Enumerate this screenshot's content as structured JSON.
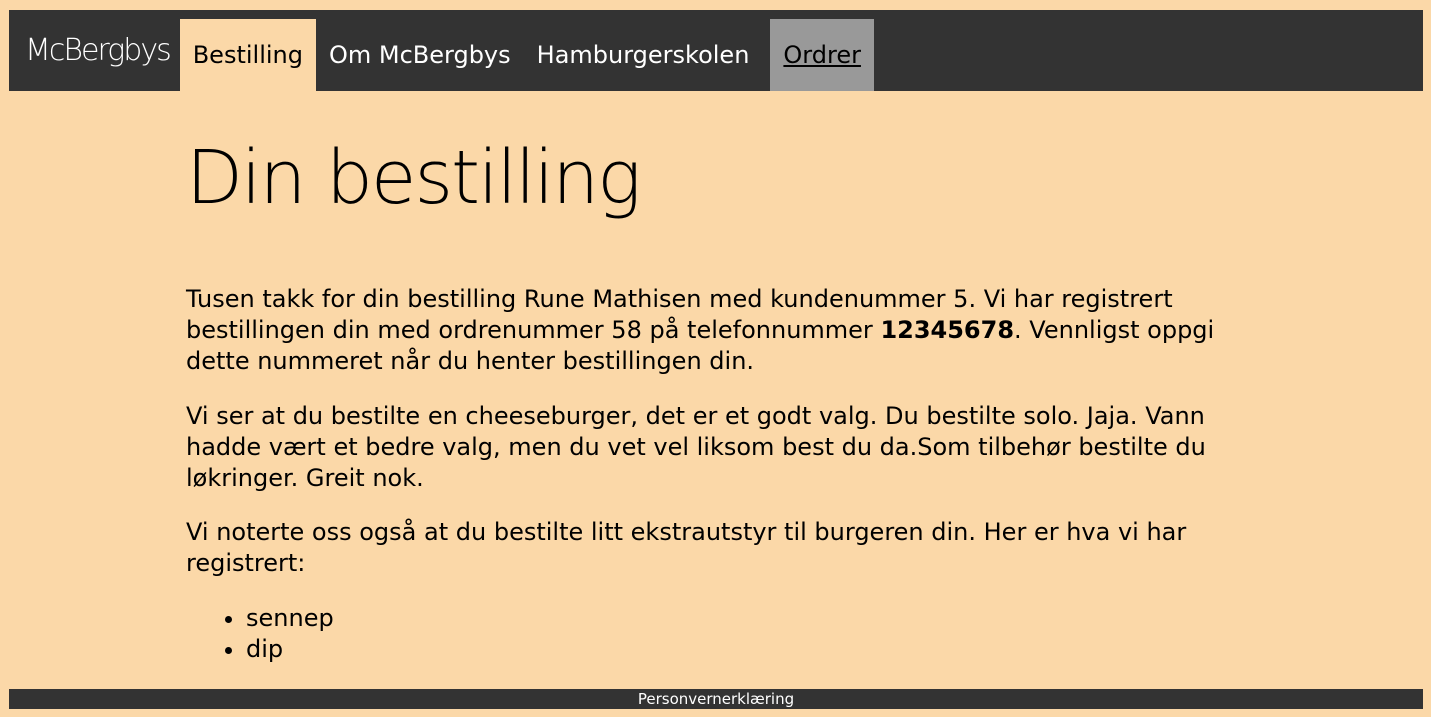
{
  "nav": {
    "brand": "McBergbys",
    "items": [
      {
        "label": "Bestilling"
      },
      {
        "label": "Om McBergbys"
      },
      {
        "label": "Hamburgerskolen"
      },
      {
        "label": "Ordrer"
      }
    ]
  },
  "main": {
    "title": "Din bestilling",
    "p1": {
      "before": "Tusen takk for din bestilling Rune Mathisen med kundenummer 5. Vi har registrert bestillingen din med ordrenummer 58 på telefonnummer ",
      "phone": "12345678",
      "after": ". Vennligst oppgi dette nummeret når du henter bestillingen din."
    },
    "p2": "Vi ser at du bestilte en cheeseburger, det er et godt valg. Du bestilte solo. Jaja. Vann hadde vært et bedre valg, men du vet vel liksom best du da.Som tilbehør bestilte du løkringer. Greit nok.",
    "p3": "Vi noterte oss også at du bestilte litt ekstrautstyr til burgeren din. Her er hva vi har registrert:",
    "extras": [
      "sennep",
      "dip"
    ]
  },
  "footer": {
    "link": "Personvernerklæring"
  },
  "colors": {
    "background": "#fbd8a8",
    "nav_background": "#333333",
    "nav_current": "#999999"
  }
}
